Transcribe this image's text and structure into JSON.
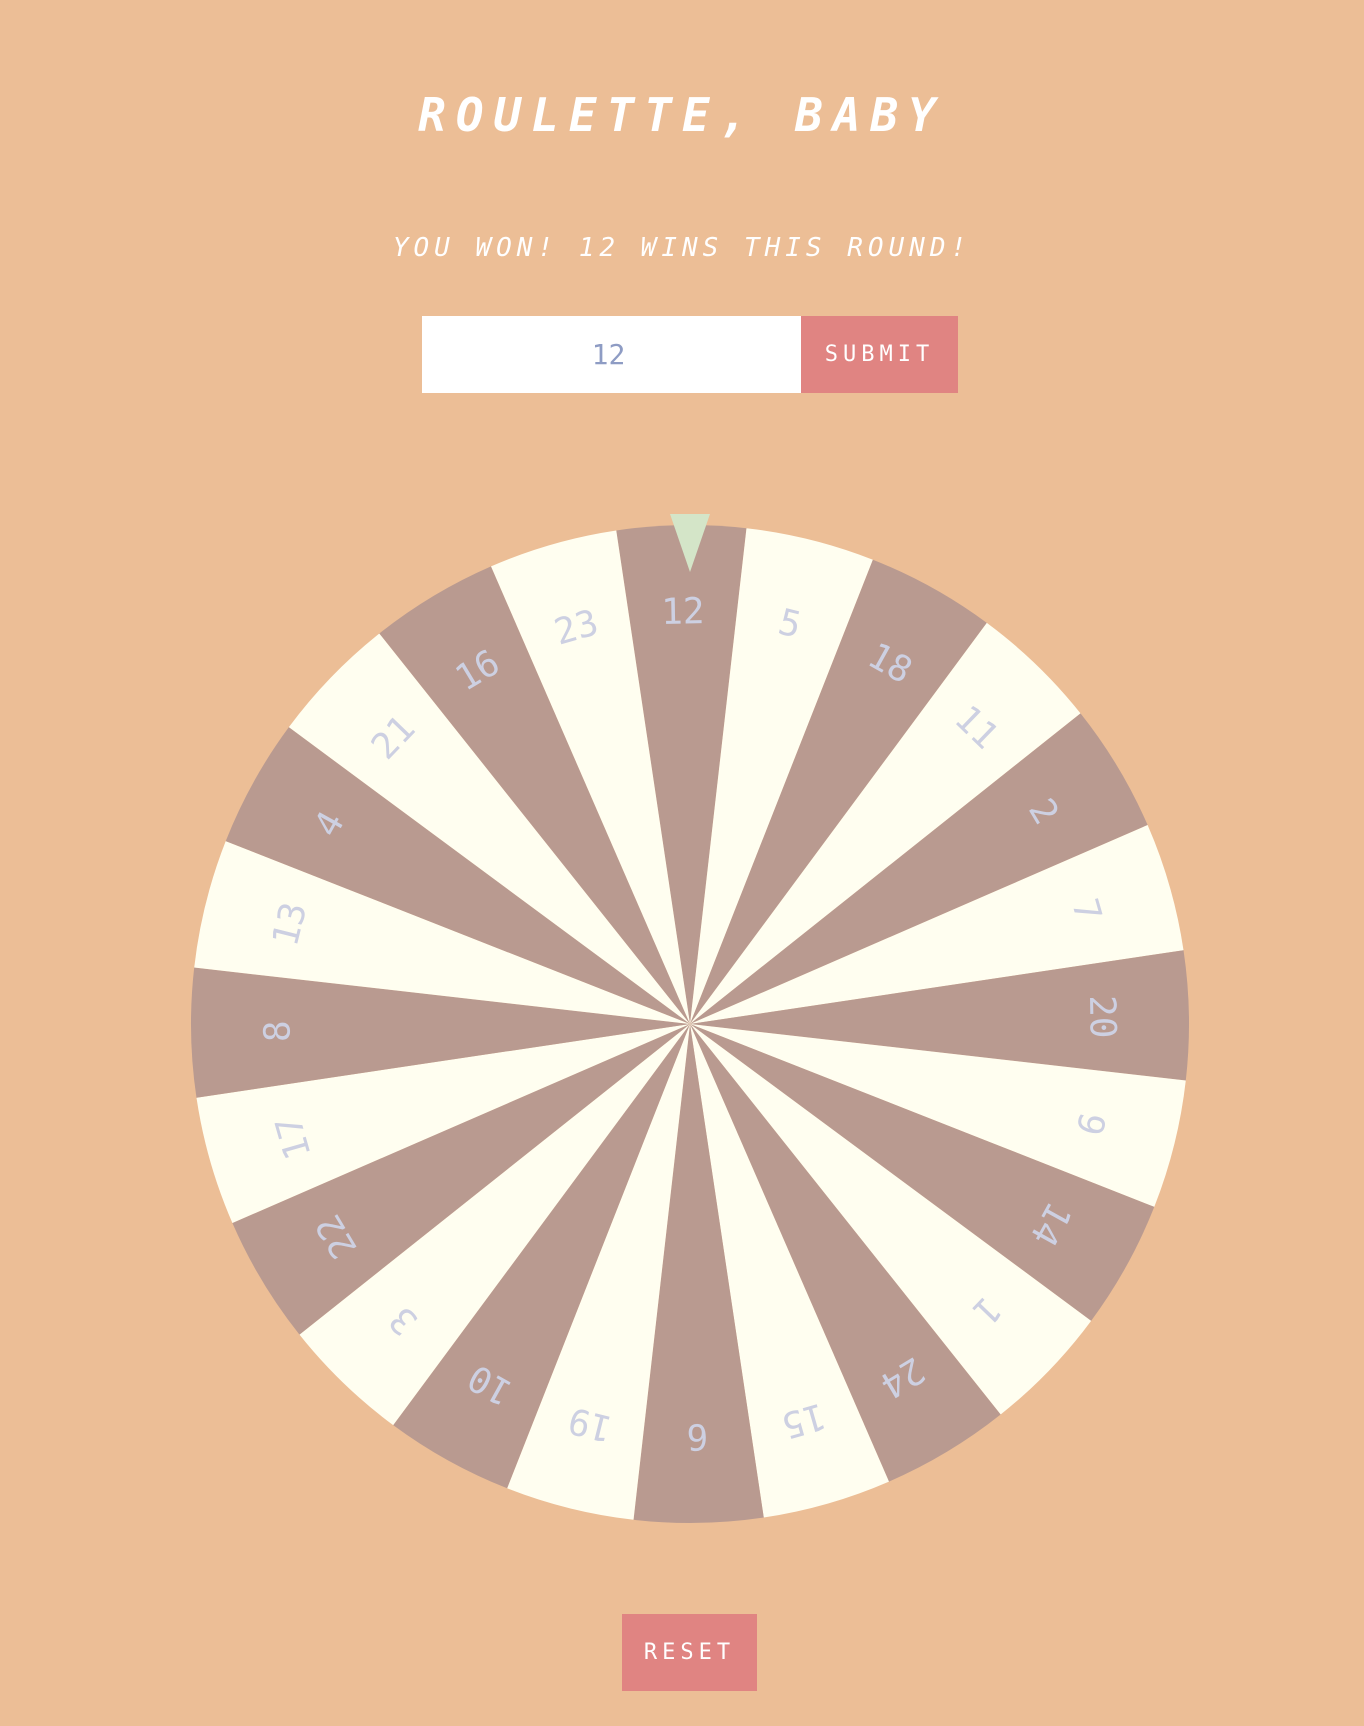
{
  "title": "ROULETTE, BABY",
  "message": "YOU WON! 12 WINS THIS ROUND!",
  "input": {
    "value": "12"
  },
  "submit_label": "SUBMIT",
  "reset_label": "RESET",
  "wheel": {
    "numbers": [
      12,
      5,
      18,
      11,
      2,
      7,
      20,
      9,
      14,
      1,
      24,
      15,
      6,
      19,
      10,
      3,
      22,
      17,
      8,
      13,
      4,
      21,
      16,
      23
    ],
    "selected": 12
  },
  "colors": {
    "background": "#ECBE96",
    "segment_dark": "#B99A90",
    "segment_light": "#FFFEF0",
    "number_text": "#CDD0E2",
    "pointer": "#D4E5C8",
    "button": "#E08482"
  }
}
